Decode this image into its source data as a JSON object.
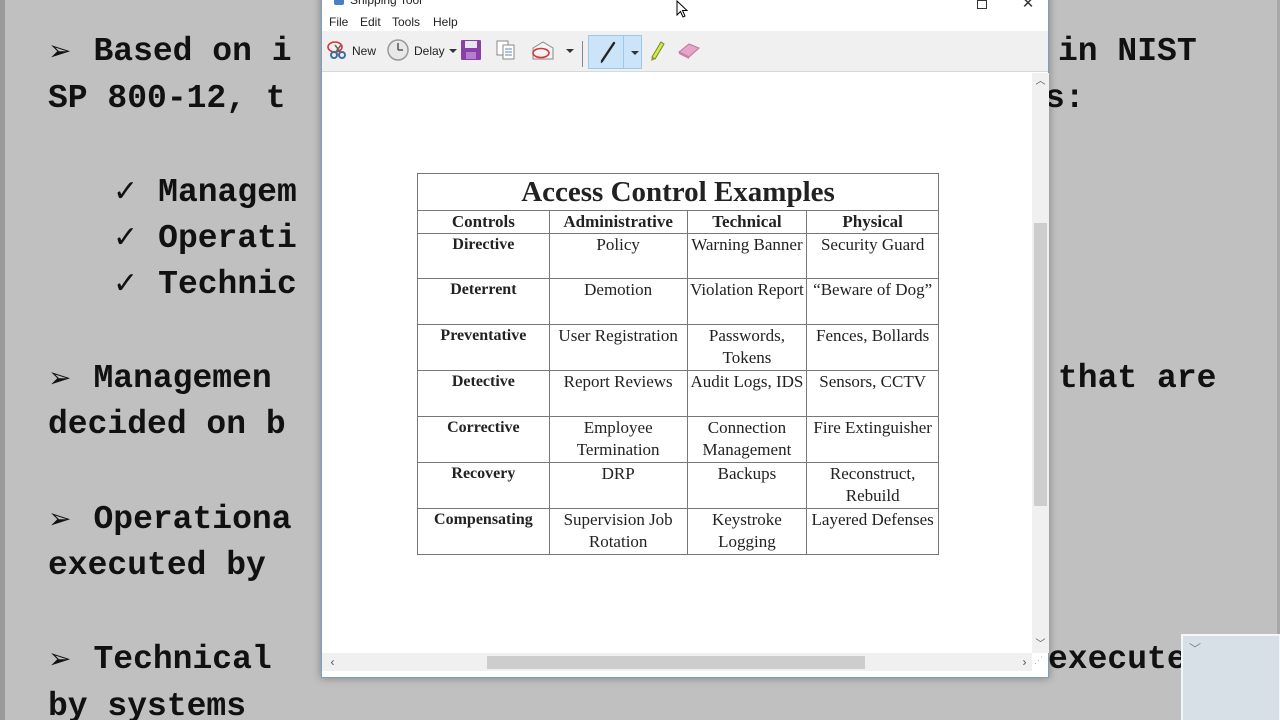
{
  "slide": {
    "lines": [
      {
        "bullet": "➢",
        "text": "Based on i",
        "tail": "in NIST"
      },
      {
        "text": "SP 800-12, t",
        "tail": "s:"
      },
      {
        "bullet": "✓",
        "text": "Managem"
      },
      {
        "bullet": "✓",
        "text": "Operati"
      },
      {
        "bullet": "✓",
        "text": "Technic"
      },
      {
        "bullet": "➢",
        "text": "Managemen",
        "tail": "that are"
      },
      {
        "text": "decided on b"
      },
      {
        "bullet": "➢",
        "text": "Operationa"
      },
      {
        "text": "executed by"
      },
      {
        "bullet": "➢",
        "text": "Technical",
        "tail": "execute"
      },
      {
        "text": "by systems"
      }
    ]
  },
  "window": {
    "title": "Snipping Tool",
    "menu": [
      "File",
      "Edit",
      "Tools",
      "Help"
    ],
    "toolbar": {
      "new_label": "New",
      "delay_label": "Delay",
      "icons": [
        "new-snip-icon",
        "delay-clock-icon",
        "save-icon",
        "copy-icon",
        "send-email-icon",
        "pen-icon",
        "highlighter-icon",
        "eraser-icon"
      ]
    }
  },
  "capture": {
    "title": "Access Control Examples",
    "columns": [
      "Controls",
      "Administrative",
      "Technical",
      "Physical"
    ],
    "rows": [
      {
        "control": "Directive",
        "administrative": "Policy",
        "technical": "Warning Banner",
        "physical": "Security Guard"
      },
      {
        "control": "Deterrent",
        "administrative": "Demotion",
        "technical": "Violation Report",
        "physical": "“Beware of Dog”"
      },
      {
        "control": "Preventative",
        "administrative": "User Registration",
        "technical": "Passwords, Tokens",
        "physical": "Fences, Bollards"
      },
      {
        "control": "Detective",
        "administrative": "Report Reviews",
        "technical": "Audit Logs, IDS",
        "physical": "Sensors, CCTV"
      },
      {
        "control": "Corrective",
        "administrative": "Employee Termination",
        "technical": "Connection Management",
        "physical": "Fire Extinguisher"
      },
      {
        "control": "Recovery",
        "administrative": "DRP",
        "technical": "Backups",
        "physical": "Reconstruct, Rebuild"
      },
      {
        "control": "Compensating",
        "administrative": "Supervision Job Rotation",
        "technical": "Keystroke Logging",
        "physical": "Layered Defenses"
      }
    ]
  },
  "colors": {
    "slide_bg": "#c0c0c0",
    "pen_selected_bg": "#cce4f7",
    "window_border": "#7d9ec0"
  }
}
